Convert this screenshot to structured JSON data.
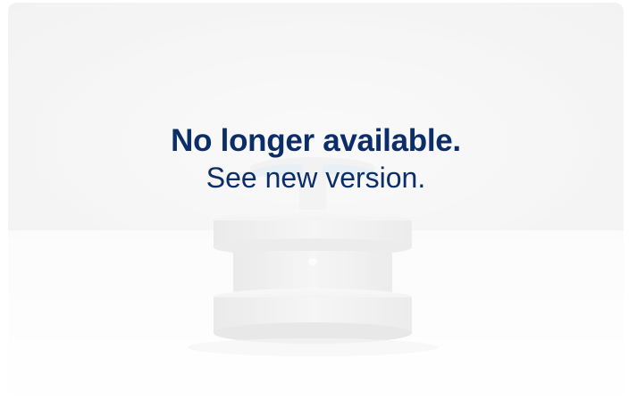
{
  "notice": {
    "headline": "No longer available.",
    "link_text": "See new version.",
    "text_color": "#0b2e6b"
  },
  "image": {
    "subject": "white cylindrical device",
    "icon": "product-image"
  }
}
